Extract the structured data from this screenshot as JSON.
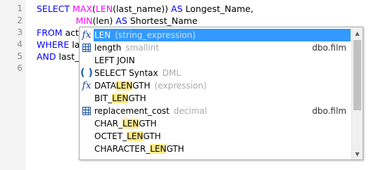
{
  "editor": {
    "line_numbers": [
      "1",
      "2",
      "3",
      "4",
      "5",
      "6"
    ],
    "lines": [
      [
        {
          "t": "SELECT ",
          "c": "kw"
        },
        {
          "t": "MAX",
          "c": "fn"
        },
        {
          "t": "(",
          "c": "plain"
        },
        {
          "t": "LEN",
          "c": "fn"
        },
        {
          "t": "(last_name)) ",
          "c": "plain"
        },
        {
          "t": "AS ",
          "c": "kw"
        },
        {
          "t": "Longest_Name,",
          "c": "plain"
        }
      ],
      [
        {
          "t": "              ",
          "c": "plain"
        },
        {
          "t": "MIN",
          "c": "fn"
        },
        {
          "t": "(len) ",
          "c": "plain"
        },
        {
          "t": "AS ",
          "c": "kw"
        },
        {
          "t": "Shortest_Name",
          "c": "plain"
        }
      ],
      [
        {
          "t": "FROM ",
          "c": "kw"
        },
        {
          "t": "act",
          "c": "plain"
        }
      ],
      [
        {
          "t": "WHERE ",
          "c": "kw"
        },
        {
          "t": "la",
          "c": "plain"
        }
      ],
      [
        {
          "t": "AND ",
          "c": "kw"
        },
        {
          "t": "last_",
          "c": "plain"
        }
      ]
    ]
  },
  "autocomplete": {
    "items": [
      {
        "icon": "function-icon",
        "parts": [
          {
            "t": "LEN",
            "h": true
          }
        ],
        "desc": "(string_expression)",
        "schema": "",
        "selected": true
      },
      {
        "icon": "table-column-icon",
        "parts": [
          {
            "t": "length",
            "h": false
          }
        ],
        "desc": "smallint",
        "schema": "dbo.film",
        "selected": false
      },
      {
        "icon": "",
        "parts": [
          {
            "t": "LEFT JOIN",
            "h": false
          }
        ],
        "desc": "",
        "schema": "",
        "selected": false
      },
      {
        "icon": "parentheses-icon",
        "parts": [
          {
            "t": "SELECT Syntax",
            "h": false
          }
        ],
        "desc": "DML",
        "schema": "",
        "selected": false
      },
      {
        "icon": "function-icon",
        "parts": [
          {
            "t": "DATA",
            "h": false
          },
          {
            "t": "LEN",
            "h": true
          },
          {
            "t": "GTH",
            "h": false
          }
        ],
        "desc": "(expression)",
        "schema": "",
        "selected": false
      },
      {
        "icon": "",
        "parts": [
          {
            "t": "BIT_",
            "h": false
          },
          {
            "t": "LEN",
            "h": true
          },
          {
            "t": "GTH",
            "h": false
          }
        ],
        "desc": "",
        "schema": "",
        "selected": false
      },
      {
        "icon": "table-column-icon",
        "parts": [
          {
            "t": "replacement_cost",
            "h": false
          }
        ],
        "desc": "decimal",
        "schema": "dbo.film",
        "selected": false
      },
      {
        "icon": "",
        "parts": [
          {
            "t": "CHAR_",
            "h": false
          },
          {
            "t": "LEN",
            "h": true
          },
          {
            "t": "GTH",
            "h": false
          }
        ],
        "desc": "",
        "schema": "",
        "selected": false
      },
      {
        "icon": "",
        "parts": [
          {
            "t": "OCTET_",
            "h": false
          },
          {
            "t": "LEN",
            "h": true
          },
          {
            "t": "GTH",
            "h": false
          }
        ],
        "desc": "",
        "schema": "",
        "selected": false
      },
      {
        "icon": "",
        "parts": [
          {
            "t": "CHARACTER_",
            "h": false
          },
          {
            "t": "LEN",
            "h": true
          },
          {
            "t": "GTH",
            "h": false
          }
        ],
        "desc": "",
        "schema": "",
        "selected": false
      }
    ]
  },
  "scrollbar": {
    "up_arrow": "▲",
    "down_arrow": "▼"
  },
  "colors": {
    "keyword": "#0000ff",
    "function": "#ff00ff",
    "selection": "#3399ff",
    "match_highlight": "#ffe98a"
  }
}
